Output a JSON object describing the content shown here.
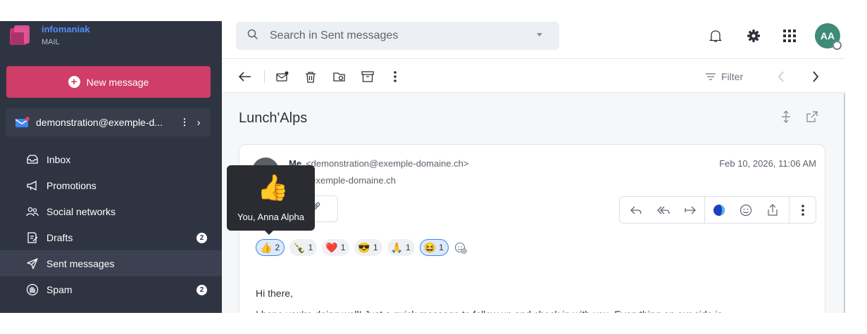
{
  "brand": {
    "name": "infomaniak",
    "product": "MAIL"
  },
  "sidebar": {
    "new_message_label": "New message",
    "account_label": "demonstration@exemple-d...",
    "folders": [
      {
        "label": "Inbox",
        "icon": "inbox-icon",
        "badge": ""
      },
      {
        "label": "Promotions",
        "icon": "megaphone-icon",
        "badge": ""
      },
      {
        "label": "Social networks",
        "icon": "people-icon",
        "badge": ""
      },
      {
        "label": "Drafts",
        "icon": "draft-icon",
        "badge": "2"
      },
      {
        "label": "Sent messages",
        "icon": "send-icon",
        "badge": "",
        "active": true
      },
      {
        "label": "Spam",
        "icon": "spam-icon",
        "badge": "2"
      }
    ]
  },
  "search": {
    "placeholder": "Search in Sent messages"
  },
  "user": {
    "initials": "AA"
  },
  "toolbar": {
    "filter_label": "Filter"
  },
  "message": {
    "subject": "Lunch'Alps",
    "from_name": "Me",
    "from_address": "<demonstration@exemple-domaine.ch>",
    "to": "faq@exemple-domaine.ch",
    "date": "Feb 10, 2026, 11:06 AM",
    "reactions": [
      {
        "emoji": "👍",
        "count": "2",
        "selected": true
      },
      {
        "emoji": "🍾",
        "count": "1"
      },
      {
        "emoji": "❤️",
        "count": "1"
      },
      {
        "emoji": "😎",
        "count": "1"
      },
      {
        "emoji": "🙏",
        "count": "1"
      },
      {
        "emoji": "😆",
        "count": "1",
        "selected": true
      }
    ],
    "body": [
      "Hi there,",
      "I hope you're doing well! Just a quick message to follow up and check in with you. Everything on our side is"
    ]
  },
  "tooltip": {
    "emoji": "👍",
    "text": "You, Anna Alpha"
  },
  "colors": {
    "sidebar": "#2f3442",
    "accent": "#cf3d68",
    "avatar": "#3e8b78",
    "link": "#4f8ff7"
  }
}
